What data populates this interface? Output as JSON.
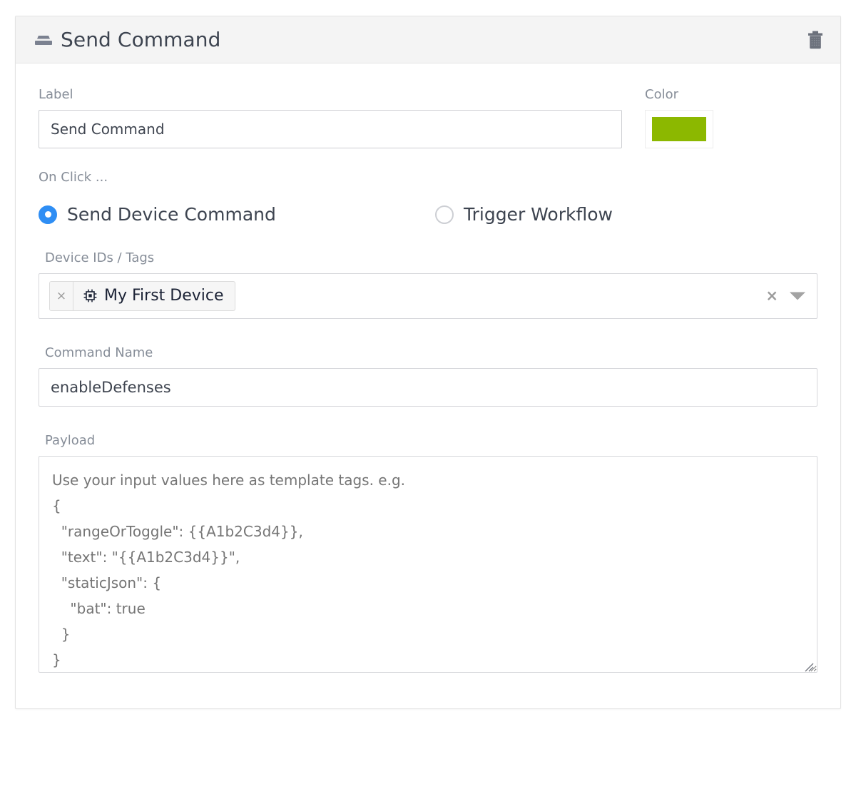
{
  "card": {
    "header": {
      "title": "Send Command",
      "drag_handle_icon": "drag-handle-icon",
      "delete_icon": "trash-icon"
    }
  },
  "fields": {
    "label": {
      "label": "Label",
      "value": "Send Command"
    },
    "color": {
      "label": "Color",
      "value": "#8cb800"
    },
    "on_click": {
      "label": "On Click ...",
      "options": [
        {
          "label": "Send Device Command",
          "selected": true
        },
        {
          "label": "Trigger Workflow",
          "selected": false
        }
      ]
    },
    "device_ids_tags": {
      "label": "Device IDs / Tags",
      "tags": [
        {
          "name": "My First Device",
          "icon": "microchip-icon",
          "remove_label": "×"
        }
      ],
      "clear_label": "×",
      "caret_icon": "chevron-down-icon"
    },
    "command_name": {
      "label": "Command Name",
      "value": "enableDefenses"
    },
    "payload": {
      "label": "Payload",
      "value": "",
      "placeholder": "Use your input values here as template tags. e.g.\n{\n  \"rangeOrToggle\": {{A1b2C3d4}},\n  \"text\": \"{{A1b2C3d4}}\",\n  \"staticJson\": {\n    \"bat\": true\n  }\n}"
    }
  },
  "colors": {
    "accent_blue": "#2f8ef4",
    "swatch_green": "#8cb800",
    "header_bg": "#f4f4f4",
    "label_gray": "#868d98",
    "text_dark": "#3d4450"
  }
}
